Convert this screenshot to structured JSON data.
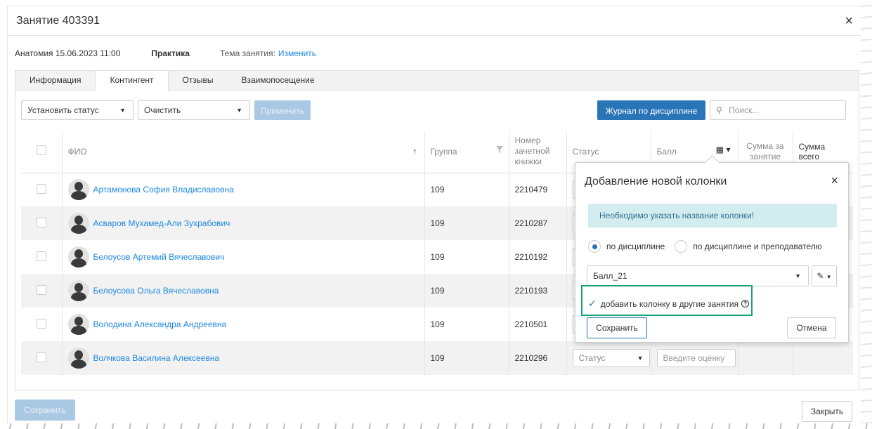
{
  "modal": {
    "title": "Занятие 403391"
  },
  "info": {
    "subject": "Анатомия 15.06.2023 11:00",
    "type": "Практика",
    "topic_label": "Тема занятия:",
    "topic_link": "Изменить"
  },
  "tabs": [
    {
      "label": "Информация",
      "active": false
    },
    {
      "label": "Контингент",
      "active": true
    },
    {
      "label": "Отзывы",
      "active": false
    },
    {
      "label": "Взаимопосещение",
      "active": false
    }
  ],
  "toolbar": {
    "set_status": "Установить статус",
    "clear": "Очистить",
    "apply": "Применить",
    "journal": "Журнал по дисциплине",
    "search_placeholder": "Поиск..."
  },
  "columns": {
    "fio": "ФИО",
    "group": "Группа",
    "record_book": "Номер зачетной книжки",
    "status": "Статус",
    "grade": "Балл",
    "sum_lesson": "Сумма за занятие",
    "sum_total": "Сумма всего"
  },
  "rows": [
    {
      "name": "Артамонова София Владиславовна",
      "group": "109",
      "book": "2210479"
    },
    {
      "name": "Асваров Мухамед-Али Зухрабович",
      "group": "109",
      "book": "2210287"
    },
    {
      "name": "Белоусов Артемий Вячеславович",
      "group": "109",
      "book": "2210192"
    },
    {
      "name": "Белоусова Ольга Вячеславовна",
      "group": "109",
      "book": "2210193"
    },
    {
      "name": "Володина Александра Андреевна",
      "group": "109",
      "book": "2210501"
    },
    {
      "name": "Волчкова Василина Алексеевна",
      "group": "109",
      "book": "2210296"
    }
  ],
  "row_status_placeholder": "Статус",
  "row_status_partial": "С",
  "row_grade_placeholder": "Введите оценку",
  "footer": {
    "save": "Сохранить",
    "close": "Закрыть"
  },
  "popover": {
    "title": "Добавление новой колонки",
    "alert": "Необходимо указать название колонки!",
    "radio1": "по дисциплине",
    "radio2": "по дисциплине и преподавателю",
    "column_name": "Балл_21",
    "checkbox_label": "добавить колонку в другие занятия",
    "help_symbol": "?",
    "save": "Сохранить",
    "cancel": "Отмена"
  },
  "icons": {
    "close": "×",
    "caret": "▼",
    "sort": "↑",
    "search": "🔍",
    "check": "✓",
    "pencil": "✎"
  },
  "colors": {
    "primary": "#2a74b8",
    "link": "#1e88e5",
    "alert_bg": "#d2ecf0",
    "highlight": "#1aa37a"
  }
}
